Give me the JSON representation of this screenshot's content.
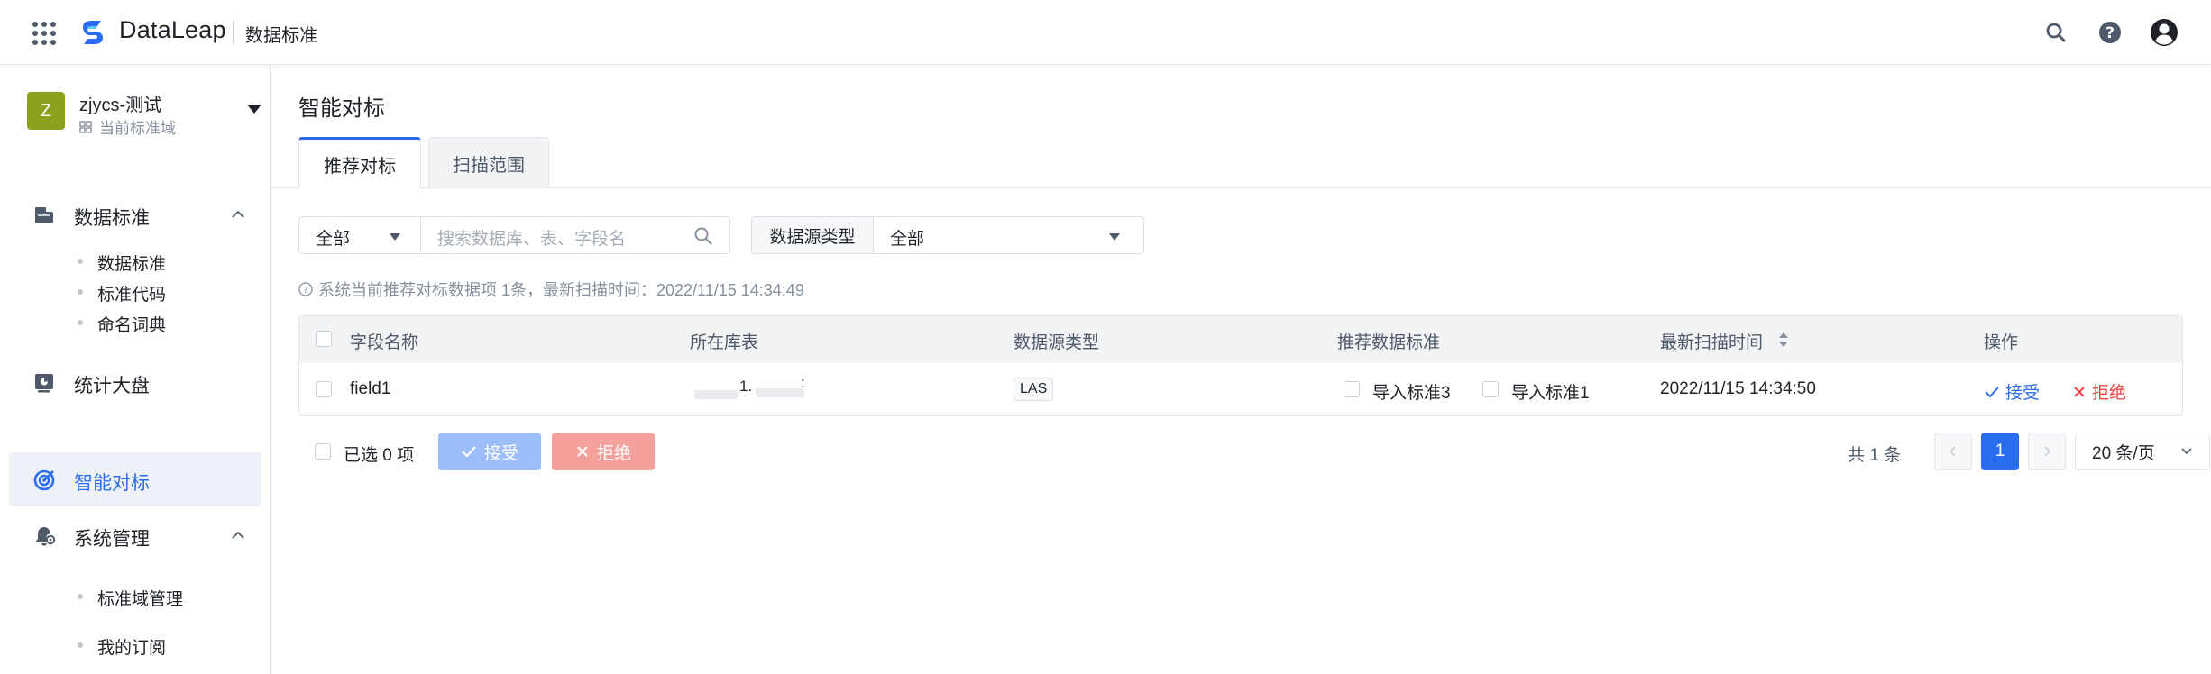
{
  "header": {
    "brand": "DataLeap",
    "module": "数据标准",
    "icons": [
      "apps-grid-icon",
      "search-icon",
      "help-icon",
      "user-avatar-icon"
    ]
  },
  "sidebar": {
    "domain": {
      "avatar_letter": "Z",
      "name": "zjycs-测试",
      "subtitle": "当前标准域"
    },
    "groups": [
      {
        "label": "数据标准",
        "icon": "folder-icon",
        "expanded": true,
        "items": [
          "数据标准",
          "标准代码",
          "命名词典"
        ]
      },
      {
        "label": "统计大盘",
        "icon": "dashboard-icon"
      },
      {
        "label": "智能对标",
        "icon": "target-icon",
        "active": true
      },
      {
        "label": "系统管理",
        "icon": "settings-bell-icon",
        "expanded": true,
        "items": [
          "标准域管理",
          "我的订阅"
        ]
      }
    ]
  },
  "main": {
    "title": "智能对标",
    "tabs": [
      {
        "label": "推荐对标",
        "active": true
      },
      {
        "label": "扫描范围",
        "active": false
      }
    ],
    "filters": {
      "scope_value": "全部",
      "search_placeholder": "搜索数据库、表、字段名",
      "dstype_label": "数据源类型",
      "dstype_value": "全部"
    },
    "info": "系统当前推荐对标数据项 1条，最新扫描时间：2022/11/15 14:34:49",
    "table": {
      "columns": [
        "字段名称",
        "所在库表",
        "数据源类型",
        "推荐数据标准",
        "最新扫描时间",
        "操作"
      ],
      "rows": [
        {
          "field": "field1",
          "table_partial": "1.",
          "table_suffix": ":",
          "ds_type": "LAS",
          "standards": [
            "导入标准3",
            "导入标准1"
          ],
          "scan_time": "2022/11/15 14:34:50",
          "accept": "接受",
          "reject": "拒绝"
        }
      ]
    },
    "footer": {
      "selected": "已选 0 项",
      "accept_label": "接受",
      "reject_label": "拒绝",
      "total": "共 1 条",
      "current_page": "1",
      "page_size": "20 条/页"
    }
  },
  "colors": {
    "primary": "#2b6df0",
    "accept_disabled": "#9cbef8",
    "reject_disabled": "#f4a09b",
    "reject_text": "#f53f3f",
    "avatar": "#8ea020"
  }
}
